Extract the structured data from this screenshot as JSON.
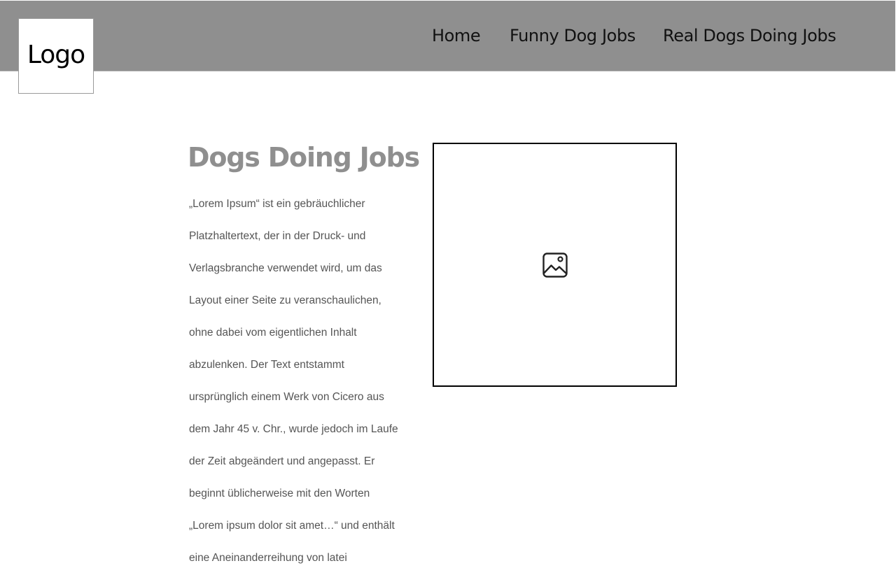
{
  "header": {
    "logo_text": "Logo",
    "nav": [
      {
        "label": "Home"
      },
      {
        "label": "Funny Dog Jobs"
      },
      {
        "label": "Real Dogs Doing Jobs"
      }
    ]
  },
  "main": {
    "title": "Dogs Doing Jobs",
    "paragraph_lines": [
      " „Lorem Ipsum“ ist ein gebräuchlicher",
      "Platzhaltertext, der in der Druck- und",
      "Verlagsbranche verwendet wird, um das",
      "Layout einer Seite zu veranschaulichen,",
      "ohne dabei vom eigentlichen Inhalt",
      "abzulenken. Der Text entstammt",
      "ursprünglich einem Werk von Cicero aus",
      "dem Jahr 45 v. Chr., wurde jedoch im Laufe",
      "der Zeit abgeändert und angepasst. Er",
      "beginnt üblicherweise mit den Worten",
      "„Lorem ipsum dolor sit amet…“ und enthält",
      "eine Aneinanderreihung von latei"
    ],
    "image_icon": "image-icon"
  },
  "colors": {
    "header_bg": "#8f8f8f",
    "title": "#8f8f8f",
    "body_text": "#555555"
  }
}
